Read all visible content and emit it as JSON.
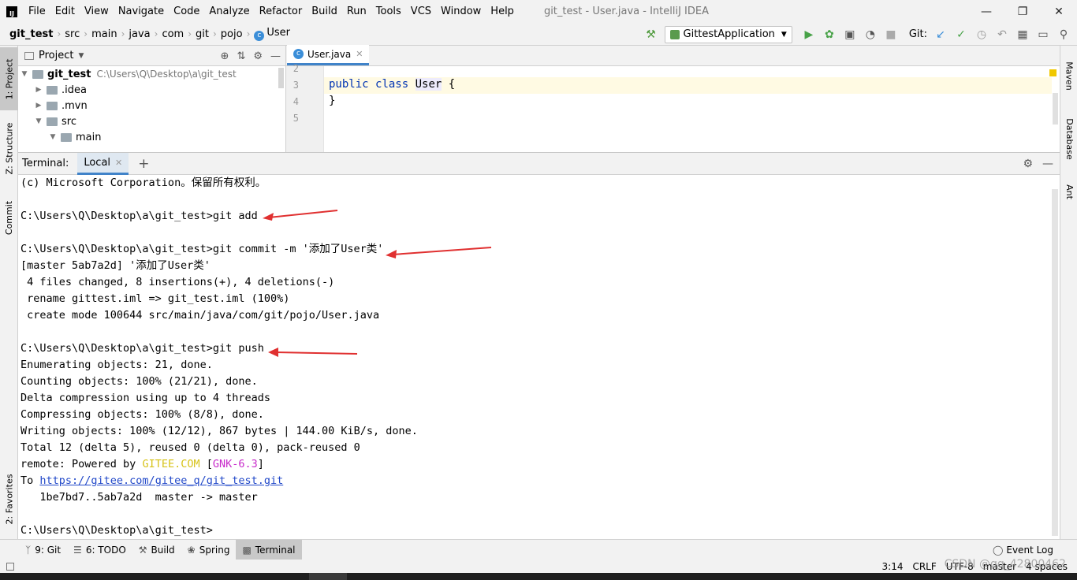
{
  "app": {
    "window_title": "git_test - User.java - IntelliJ IDEA"
  },
  "menu": [
    "File",
    "Edit",
    "View",
    "Navigate",
    "Code",
    "Analyze",
    "Refactor",
    "Build",
    "Run",
    "Tools",
    "VCS",
    "Window",
    "Help"
  ],
  "breadcrumb": [
    "git_test",
    "src",
    "main",
    "java",
    "com",
    "git",
    "pojo",
    "User"
  ],
  "toolbar": {
    "run_config": "GittestApplication",
    "git_label": "Git:"
  },
  "left_tabs": {
    "project": "1: Project",
    "structure": "Z: Structure",
    "commit": "Commit",
    "favorites": "2: Favorites"
  },
  "right_tabs": {
    "maven": "Maven",
    "database": "Database",
    "ant": "Ant"
  },
  "project": {
    "title": "Project",
    "tree": [
      {
        "label": "git_test",
        "path": "C:\\Users\\Q\\Desktop\\a\\git_test",
        "expanded": true
      },
      {
        "label": ".idea",
        "expanded": false
      },
      {
        "label": ".mvn",
        "expanded": false
      },
      {
        "label": "src",
        "expanded": true
      },
      {
        "label": "main",
        "expanded": true
      }
    ]
  },
  "editor": {
    "tab": "User.java",
    "line_numbers": [
      "2",
      "3",
      "4",
      "5"
    ],
    "code": {
      "kw_public": "public",
      "kw_class": "class",
      "class_name": "User",
      "open_brace": "{",
      "close_brace": "}"
    }
  },
  "terminal": {
    "title": "Terminal:",
    "tab": "Local",
    "lines": {
      "l1": "(c) Microsoft Corporation。保留所有权利。",
      "l2": "",
      "l3": "C:\\Users\\Q\\Desktop\\a\\git_test>git add .",
      "l4": "",
      "l5": "C:\\Users\\Q\\Desktop\\a\\git_test>git commit -m '添加了User类'",
      "l6": "[master 5ab7a2d] '添加了User类'",
      "l7": " 4 files changed, 8 insertions(+), 4 deletions(-)",
      "l8": " rename gittest.iml => git_test.iml (100%)",
      "l9": " create mode 100644 src/main/java/com/git/pojo/User.java",
      "l10": "",
      "l11": "C:\\Users\\Q\\Desktop\\a\\git_test>git push",
      "l12": "Enumerating objects: 21, done.",
      "l13": "Counting objects: 100% (21/21), done.",
      "l14": "Delta compression using up to 4 threads",
      "l15": "Compressing objects: 100% (8/8), done.",
      "l16": "Writing objects: 100% (12/12), 867 bytes | 144.00 KiB/s, done.",
      "l17": "Total 12 (delta 5), reused 0 (delta 0), pack-reused 0",
      "l18_prefix": "remote: Powered by ",
      "l18_gitee": "GITEE.COM",
      "l18_open": " [",
      "l18_gnk": "GNK-6.3",
      "l18_close": "]",
      "l19_prefix": "To ",
      "l19_link": "https://gitee.com/gitee_q/git_test.git",
      "l20": "   1be7bd7..5ab7a2d  master -> master",
      "l21": "",
      "l22": "C:\\Users\\Q\\Desktop\\a\\git_test>"
    }
  },
  "tool_windows": [
    {
      "label": "9: Git",
      "icon": "git-icon"
    },
    {
      "label": "6: TODO",
      "icon": "todo-icon"
    },
    {
      "label": "Build",
      "icon": "hammer-icon"
    },
    {
      "label": "Spring",
      "icon": "spring-icon"
    },
    {
      "label": "Terminal",
      "icon": "terminal-icon"
    }
  ],
  "event_log": "Event Log",
  "status": {
    "position": "3:14",
    "line_sep": "CRLF",
    "encoding": "UTF-8",
    "branch": "master",
    "indent": "4 spaces"
  },
  "watermark": "CSDN @qq_42800462",
  "colors": {
    "accent": "#4083c9",
    "arrow": "#e03030",
    "gitee": "#d7c31a",
    "gnk": "#c82bcb"
  }
}
